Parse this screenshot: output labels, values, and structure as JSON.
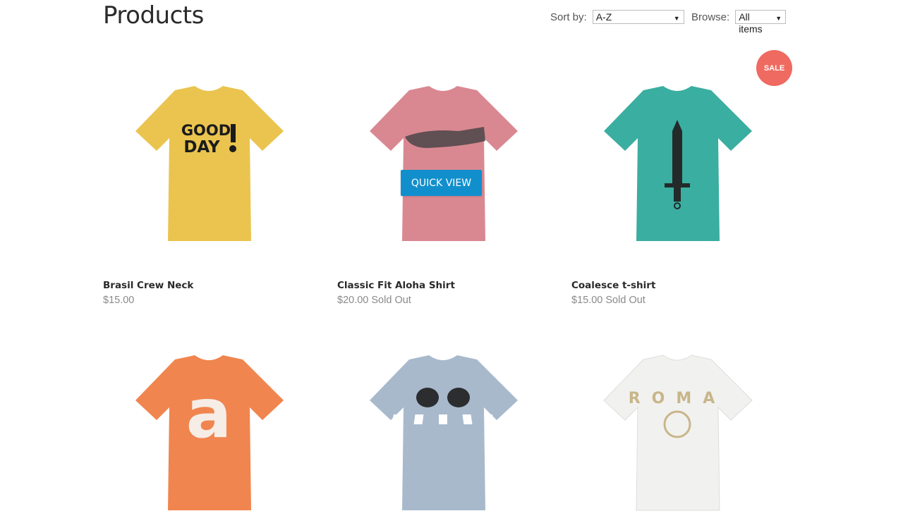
{
  "page": {
    "title": "Products"
  },
  "sort": {
    "label": "Sort by:",
    "value": "A-Z"
  },
  "browse": {
    "label": "Browse:",
    "value": "All items"
  },
  "badge": {
    "sale": "SALE"
  },
  "quick_view_label": "QUICK VIEW",
  "products": [
    {
      "name": "Brasil Crew Neck",
      "price": "$15.00",
      "status": "",
      "color": "#eac44f",
      "print": "GOOD DAY!"
    },
    {
      "name": "Classic Fit Aloha Shirt",
      "price": "$20.00",
      "status": "Sold Out",
      "color": "#d98892",
      "print": "crocodile"
    },
    {
      "name": "Coalesce t-shirt",
      "price": "$15.00",
      "status": "Sold Out",
      "color": "#3aaea0",
      "print": "pencil-dagger"
    },
    {
      "name": "",
      "price": "",
      "status": "",
      "color": "#f0854f",
      "print": "a"
    },
    {
      "name": "",
      "price": "",
      "status": "",
      "color": "#a8b9cc",
      "print": "crosswalk"
    },
    {
      "name": "",
      "price": "",
      "status": "",
      "color": "#f1f1ef",
      "print": "ROMA"
    }
  ]
}
